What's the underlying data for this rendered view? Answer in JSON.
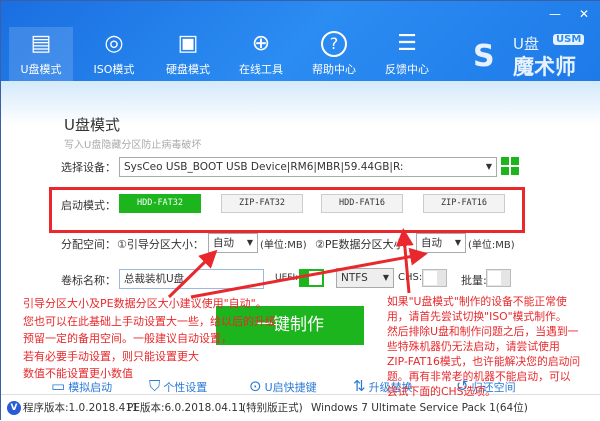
{
  "window": {
    "minimize": "—",
    "close": "✕"
  },
  "tabs": [
    {
      "label": "U盘模式",
      "icon": "usb-drive-icon",
      "glyph": "▤"
    },
    {
      "label": "ISO模式",
      "icon": "disc-icon",
      "glyph": "◎"
    },
    {
      "label": "硬盘模式",
      "icon": "hard-disk-icon",
      "glyph": "▣"
    },
    {
      "label": "在线工具",
      "icon": "globe-icon",
      "glyph": "⊕"
    },
    {
      "label": "帮助中心",
      "icon": "help-icon",
      "glyph": "?"
    },
    {
      "label": "反馈中心",
      "icon": "chat-icon",
      "glyph": "☰"
    }
  ],
  "logo": {
    "text": "U盘",
    "badge": "USM",
    "name": "魔术师"
  },
  "page": {
    "title": "U盘模式",
    "subtitle": "写入U盘隐藏分区防止病毒破坏"
  },
  "device": {
    "label": "选择设备：",
    "value": "SysCeo USB_BOOT USB Device|RM6|MBR|59.44GB|R:"
  },
  "boot_mode": {
    "label": "启动模式：",
    "options": [
      "HDD-FAT32",
      "ZIP-FAT32",
      "HDD-FAT16",
      "ZIP-FAT16"
    ],
    "selected": "HDD-FAT32"
  },
  "alloc": {
    "label": "分配空间：",
    "boot_label": "①引导分区大小：",
    "boot_value": "自动",
    "unit1": "(单位:MB)",
    "pe_label": "②PE数据分区大小",
    "pe_value": "自动",
    "unit2": "(单位:MB)"
  },
  "volume": {
    "label": "卷标名称：",
    "value": "总裁装机U盘",
    "uefi_label": "UEFI:",
    "uefi_on": true,
    "fs_value": "NTFS",
    "chs_label": "CHS:",
    "chs_on": false,
    "batch_label": "批量:",
    "batch_on": false
  },
  "make_button": "一键制作",
  "links": [
    "模拟启动",
    "个性设置",
    "U启快捷键",
    "升级替换",
    "归还空间"
  ],
  "notes": {
    "left": [
      "引导分区大小及PE数据分区大小建议使用\"自动\"。",
      "您也可以在此基础上手动设置大一些，给以后的升级",
      "预留一定的备用空间。一般建议自动设置，",
      "若有必要手动设置，则只能设置更大",
      "数值不能设置更小数值"
    ],
    "right": [
      "如果\"U盘模式\"制作的设备不能正常使",
      "用，请首先尝试切换\"ISO\"模式制作。",
      "然后排除U盘和制作问题之后，当遇到一",
      "些特殊机器仍无法启动，请尝试使用",
      "ZIP-FAT16模式，也许能解决您的启动问",
      "题。再有非常老的机器不能启动，可以",
      "尝试下面的CHS选项。"
    ]
  },
  "footer": {
    "badge": "V",
    "program_version": "程序版本:1.0.2018.411",
    "pe_version": "PE版本:6.0.2018.04.11",
    "edition": "(特别版正式)",
    "os": "Windows 7 Ultimate Service Pack 1(64位)"
  },
  "colors": {
    "header": "#2b8cf2",
    "accent_green": "#1db51d",
    "annotation_red": "#e8282c",
    "link_blue": "#2a7ad6"
  }
}
